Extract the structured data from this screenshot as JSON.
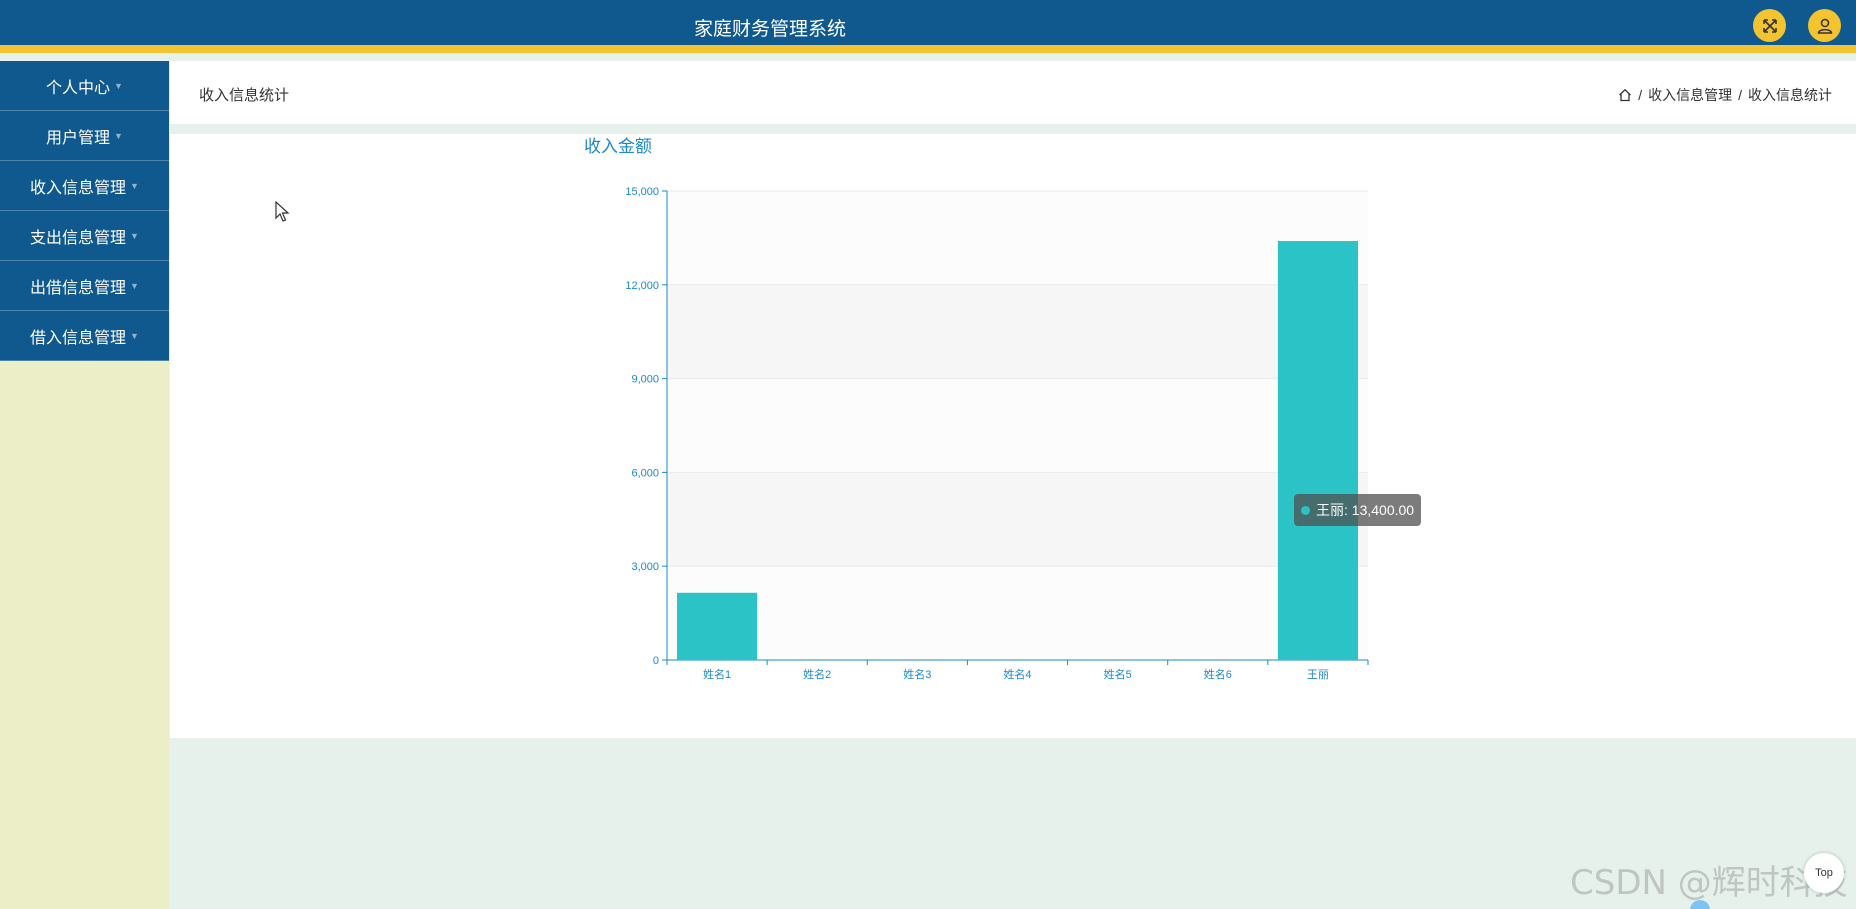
{
  "header": {
    "title": "家庭财务管理系统"
  },
  "icons": {
    "fullscreen": "fullscreen-icon",
    "user": "user-icon",
    "home": "home-icon",
    "caret": "caret-down-icon"
  },
  "sidebar": {
    "items": [
      {
        "label": "个人中心"
      },
      {
        "label": "用户管理"
      },
      {
        "label": "收入信息管理"
      },
      {
        "label": "支出信息管理"
      },
      {
        "label": "出借信息管理"
      },
      {
        "label": "借入信息管理"
      }
    ]
  },
  "page": {
    "title": "收入信息统计"
  },
  "breadcrumb": {
    "sep": "/",
    "items": [
      "收入信息管理",
      "收入信息统计"
    ]
  },
  "chart_data": {
    "type": "bar",
    "title": "收入金额",
    "categories": [
      "姓名1",
      "姓名2",
      "姓名3",
      "姓名4",
      "姓名5",
      "姓名6",
      "王丽"
    ],
    "values": [
      2150,
      0,
      0,
      0,
      0,
      0,
      13400
    ],
    "ylim": [
      0,
      15000
    ],
    "yticks": [
      "0",
      "3,000",
      "6,000",
      "9,000",
      "12,000",
      "15,000"
    ],
    "color": "#2bc3c5",
    "grid": "alternating horizontal bands"
  },
  "tooltip": {
    "text": "王丽: 13,400.00"
  },
  "scroll_top": {
    "label": "Top"
  },
  "watermark": "CSDN @辉时科技",
  "colors": {
    "header": "#10598f",
    "accent": "#f4c430",
    "sidebar_bg": "#ebeec6",
    "bar": "#2bc3c5",
    "axis": "#1e88c7"
  }
}
